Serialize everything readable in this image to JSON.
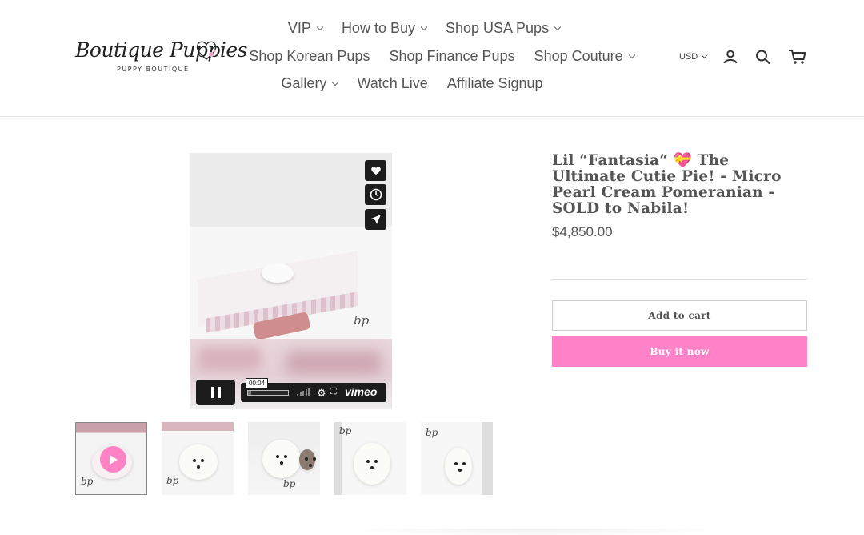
{
  "brand": {
    "logo_script": "Boutique Puppies",
    "logo_tagline": "PUPPY BOUTIQUE"
  },
  "nav": {
    "row1": [
      {
        "label": "VIP",
        "dropdown": true
      },
      {
        "label": "How to Buy",
        "dropdown": true
      },
      {
        "label": "Shop USA Pups",
        "dropdown": true
      }
    ],
    "row2": [
      {
        "label": "Shop Korean Pups",
        "dropdown": false
      },
      {
        "label": "Shop Finance Pups",
        "dropdown": false
      },
      {
        "label": "Shop Couture",
        "dropdown": true
      }
    ],
    "row3": [
      {
        "label": "Gallery",
        "dropdown": true
      },
      {
        "label": "Watch Live",
        "dropdown": false
      },
      {
        "label": "Affiliate Signup",
        "dropdown": false
      }
    ]
  },
  "tools": {
    "currency": "USD",
    "icons": [
      "account-icon",
      "search-icon",
      "cart-icon"
    ]
  },
  "video": {
    "time": "00:04",
    "progress": 0.08,
    "player_logo": "vimeo",
    "watermark": "bp"
  },
  "thumbnails": {
    "count": 5,
    "active_index": 0,
    "watermark": "bp"
  },
  "product": {
    "title": "Lil “Fantasia“ 💝 The Ultimate Cutie Pie! - Micro Pearl Cream Pomeranian - SOLD to Nabila!",
    "price": "$4,850.00",
    "add_to_cart": "Add to cart",
    "buy_now": "Buy it now"
  },
  "colors": {
    "accent_pink": "#ff82c9",
    "text_gray": "#555555"
  }
}
